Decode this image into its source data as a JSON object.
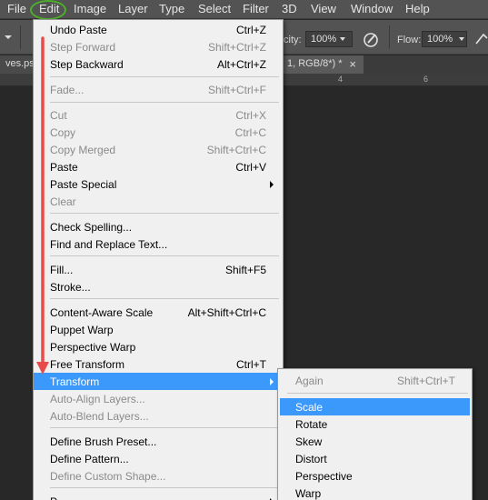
{
  "menubar": {
    "items": [
      "File",
      "Edit",
      "Image",
      "Layer",
      "Type",
      "Select",
      "Filter",
      "3D",
      "View",
      "Window",
      "Help"
    ]
  },
  "options_bar": {
    "opacity_label": "city:",
    "opacity_value": "100%",
    "flow_label": "Flow:",
    "flow_value": "100%"
  },
  "tabs": {
    "left_tab": "ves.psd",
    "right_tab": "1, RGB/8*) *",
    "close_glyph": "×"
  },
  "ruler": {
    "ticks": [
      "4",
      "6"
    ]
  },
  "edit_menu": {
    "items": [
      {
        "label": "Undo Paste",
        "shortcut": "Ctrl+Z",
        "enabled": true
      },
      {
        "label": "Step Forward",
        "shortcut": "Shift+Ctrl+Z",
        "enabled": false
      },
      {
        "label": "Step Backward",
        "shortcut": "Alt+Ctrl+Z",
        "enabled": true
      },
      {
        "label": "Fade...",
        "shortcut": "Shift+Ctrl+F",
        "enabled": false
      },
      {
        "label": "Cut",
        "shortcut": "Ctrl+X",
        "enabled": false
      },
      {
        "label": "Copy",
        "shortcut": "Ctrl+C",
        "enabled": false
      },
      {
        "label": "Copy Merged",
        "shortcut": "Shift+Ctrl+C",
        "enabled": false
      },
      {
        "label": "Paste",
        "shortcut": "Ctrl+V",
        "enabled": true
      },
      {
        "label": "Paste Special",
        "shortcut": "",
        "enabled": true,
        "submenu": true
      },
      {
        "label": "Clear",
        "shortcut": "",
        "enabled": false
      },
      {
        "label": "Check Spelling...",
        "shortcut": "",
        "enabled": true
      },
      {
        "label": "Find and Replace Text...",
        "shortcut": "",
        "enabled": true
      },
      {
        "label": "Fill...",
        "shortcut": "Shift+F5",
        "enabled": true
      },
      {
        "label": "Stroke...",
        "shortcut": "",
        "enabled": true
      },
      {
        "label": "Content-Aware Scale",
        "shortcut": "Alt+Shift+Ctrl+C",
        "enabled": true
      },
      {
        "label": "Puppet Warp",
        "shortcut": "",
        "enabled": true
      },
      {
        "label": "Perspective Warp",
        "shortcut": "",
        "enabled": true
      },
      {
        "label": "Free Transform",
        "shortcut": "Ctrl+T",
        "enabled": true
      },
      {
        "label": "Transform",
        "shortcut": "",
        "enabled": true,
        "submenu": true,
        "highlighted": true
      },
      {
        "label": "Auto-Align Layers...",
        "shortcut": "",
        "enabled": false
      },
      {
        "label": "Auto-Blend Layers...",
        "shortcut": "",
        "enabled": false
      },
      {
        "label": "Define Brush Preset...",
        "shortcut": "",
        "enabled": true
      },
      {
        "label": "Define Pattern...",
        "shortcut": "",
        "enabled": true
      },
      {
        "label": "Define Custom Shape...",
        "shortcut": "",
        "enabled": false
      },
      {
        "label": "P",
        "shortcut": "",
        "enabled": true,
        "submenu": true
      }
    ]
  },
  "transform_submenu": {
    "items": [
      {
        "label": "Again",
        "shortcut": "Shift+Ctrl+T",
        "enabled": false
      },
      {
        "label": "Scale",
        "shortcut": "",
        "enabled": true,
        "highlighted": true
      },
      {
        "label": "Rotate",
        "shortcut": "",
        "enabled": true
      },
      {
        "label": "Skew",
        "shortcut": "",
        "enabled": true
      },
      {
        "label": "Distort",
        "shortcut": "",
        "enabled": true
      },
      {
        "label": "Perspective",
        "shortcut": "",
        "enabled": true
      },
      {
        "label": "Warp",
        "shortcut": "",
        "enabled": true
      }
    ]
  },
  "colors": {
    "highlight": "#3b99fc",
    "annotation_red": "#e94b4b",
    "annotation_green": "#4caf2a"
  }
}
